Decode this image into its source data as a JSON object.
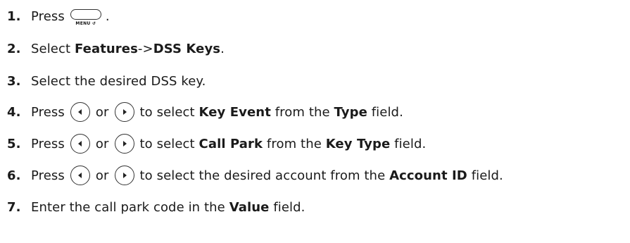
{
  "steps": [
    {
      "number": "1.",
      "parts": {
        "press": "Press",
        "dot": "."
      },
      "icons": [
        "menu-key-icon"
      ],
      "menu_caption": "MENU ↺"
    },
    {
      "number": "2.",
      "parts": {
        "lead": "Select",
        "bold": "Features",
        "arrow": "->",
        "bold2": "DSS Keys",
        "end": "."
      }
    },
    {
      "number": "3.",
      "parts": {
        "text": "Select the desired DSS key."
      }
    },
    {
      "number": "4.",
      "parts": {
        "press": "Press",
        "or": "or",
        "mid": "to select",
        "bold1": "Key Event",
        "from": "from the",
        "bold2": "Type",
        "end": "field."
      },
      "icons": [
        "left-arrow-key-icon",
        "right-arrow-key-icon"
      ]
    },
    {
      "number": "5.",
      "parts": {
        "press": "Press",
        "or": "or",
        "mid": "to select",
        "bold1": "Call Park",
        "from": "from the",
        "bold2": "Key Type",
        "end": "field."
      },
      "icons": [
        "left-arrow-key-icon",
        "right-arrow-key-icon"
      ]
    },
    {
      "number": "6.",
      "parts": {
        "press": "Press",
        "or": "or",
        "mid": "to select the desired account from the",
        "bold2": "Account ID",
        "end": "field."
      },
      "icons": [
        "left-arrow-key-icon",
        "right-arrow-key-icon"
      ]
    },
    {
      "number": "7.",
      "parts": {
        "lead": "Enter the call park code in the",
        "bold": "Value",
        "end": "field."
      }
    }
  ]
}
